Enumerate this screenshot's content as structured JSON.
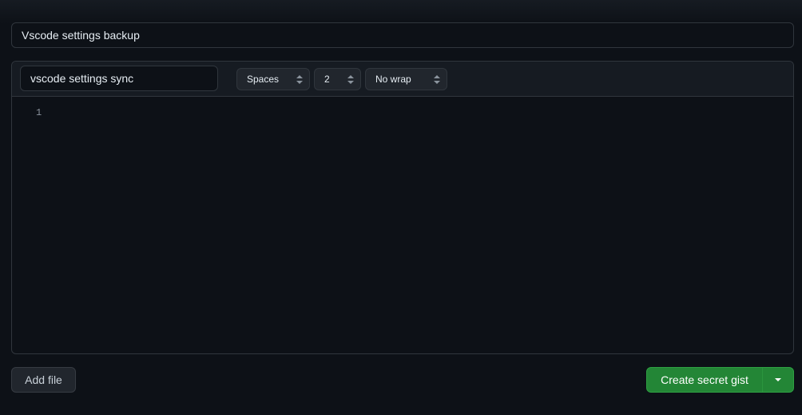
{
  "gist": {
    "description_value": "Vscode settings backup",
    "filename_value": "vscode settings sync",
    "indent_mode": "Spaces",
    "indent_size": "2",
    "wrap_mode": "No wrap",
    "line_number": "1"
  },
  "actions": {
    "add_file_label": "Add file",
    "create_label": "Create secret gist",
    "caret_icon": "triangle-down-icon"
  },
  "colors": {
    "background": "#0d1117",
    "header": "#161b22",
    "border": "#30363d",
    "primary": "#238636"
  }
}
